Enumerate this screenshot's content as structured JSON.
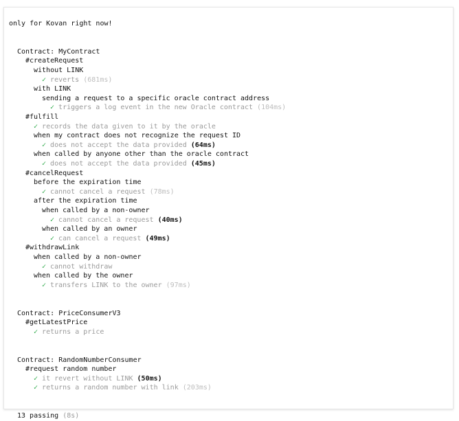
{
  "header": {
    "note": "only for Kovan right now!"
  },
  "colors": {
    "check": "#28a745",
    "passing_text": "#9a9a9a",
    "slow_time": "#bdbdbd",
    "text": "#111111"
  },
  "lines": [
    {
      "type": "note",
      "text": "only for Kovan right now!",
      "indent": 0
    },
    {
      "type": "suite",
      "text": "Contract: MyContract",
      "indent": 1
    },
    {
      "type": "suite",
      "text": "#createRequest",
      "indent": 2
    },
    {
      "type": "suite",
      "text": "without LINK",
      "indent": 3
    },
    {
      "type": "test",
      "text": "reverts",
      "time": "(681ms)",
      "time_style": "slow",
      "indent": 4
    },
    {
      "type": "suite",
      "text": "with LINK",
      "indent": 3
    },
    {
      "type": "suite",
      "text": "sending a request to a specific oracle contract address",
      "indent": 4
    },
    {
      "type": "test",
      "text": "triggers a log event in the new Oracle contract",
      "time": "(104ms)",
      "time_style": "slow",
      "indent": 5
    },
    {
      "type": "suite",
      "text": "#fulfill",
      "indent": 2
    },
    {
      "type": "test",
      "text": "records the data given to it by the oracle",
      "indent": 3
    },
    {
      "type": "suite",
      "text": "when my contract does not recognize the request ID",
      "indent": 3
    },
    {
      "type": "test",
      "text": "does not accept the data provided",
      "time": "(64ms)",
      "time_style": "med",
      "indent": 4
    },
    {
      "type": "suite",
      "text": "when called by anyone other than the oracle contract",
      "indent": 3
    },
    {
      "type": "test",
      "text": "does not accept the data provided",
      "time": "(45ms)",
      "time_style": "med",
      "indent": 4
    },
    {
      "type": "suite",
      "text": "#cancelRequest",
      "indent": 2
    },
    {
      "type": "suite",
      "text": "before the expiration time",
      "indent": 3
    },
    {
      "type": "test",
      "text": "cannot cancel a request",
      "time": "(78ms)",
      "time_style": "slow",
      "indent": 4
    },
    {
      "type": "suite",
      "text": "after the expiration time",
      "indent": 3
    },
    {
      "type": "suite",
      "text": "when called by a non-owner",
      "indent": 4
    },
    {
      "type": "test",
      "text": "cannot cancel a request",
      "time": "(40ms)",
      "time_style": "med",
      "indent": 5
    },
    {
      "type": "suite",
      "text": "when called by an owner",
      "indent": 4
    },
    {
      "type": "test",
      "text": "can cancel a request",
      "time": "(49ms)",
      "time_style": "med",
      "indent": 5
    },
    {
      "type": "suite",
      "text": "#withdrawLink",
      "indent": 2
    },
    {
      "type": "suite",
      "text": "when called by a non-owner",
      "indent": 3
    },
    {
      "type": "test",
      "text": "cannot withdraw",
      "indent": 4
    },
    {
      "type": "suite",
      "text": "when called by the owner",
      "indent": 3
    },
    {
      "type": "test",
      "text": "transfers LINK to the owner",
      "time": "(97ms)",
      "time_style": "slow",
      "indent": 4
    },
    {
      "type": "suite",
      "text": "Contract: PriceConsumerV3",
      "indent": 1
    },
    {
      "type": "suite",
      "text": "#getLatestPrice",
      "indent": 2
    },
    {
      "type": "test",
      "text": "returns a price",
      "indent": 3
    },
    {
      "type": "suite",
      "text": "Contract: RandomNumberConsumer",
      "indent": 1
    },
    {
      "type": "suite",
      "text": "#request random number",
      "indent": 2
    },
    {
      "type": "test",
      "text": "it revert without LINK",
      "time": "(50ms)",
      "time_style": "med",
      "indent": 3
    },
    {
      "type": "test",
      "text": "returns a random number with link",
      "time": "(203ms)",
      "time_style": "slow",
      "indent": 3
    }
  ],
  "summary": {
    "count": "13 passing",
    "duration": "(8s)"
  },
  "icons": {
    "check": "check-icon"
  }
}
